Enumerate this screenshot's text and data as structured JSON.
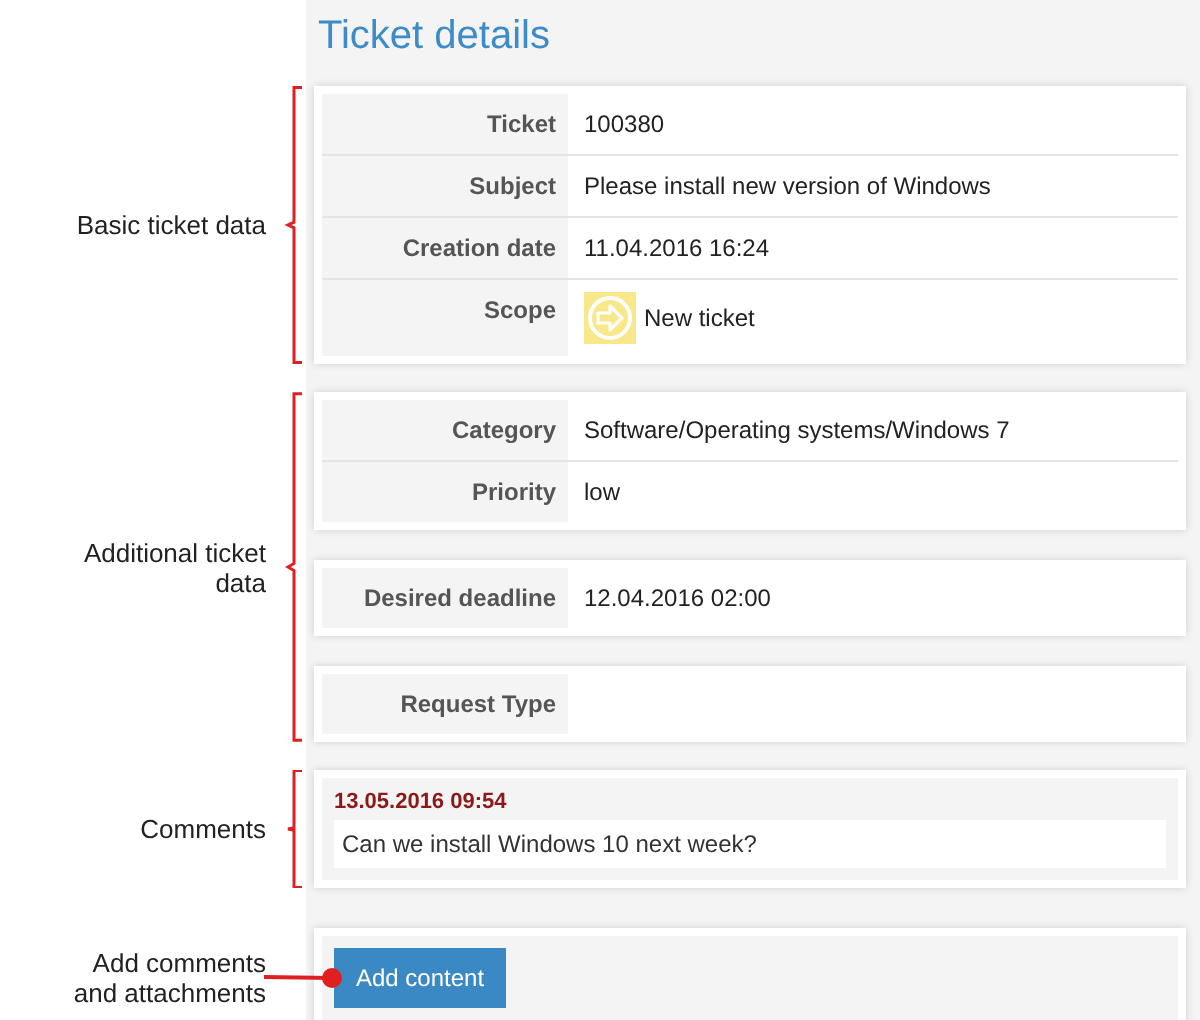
{
  "title": "Ticket details",
  "sections": [
    {
      "annotation": "Basic ticket data",
      "kind": "brace",
      "cards": [
        {
          "kind": "fields",
          "rows": [
            {
              "kind": "text",
              "label": "Ticket",
              "value": "100380"
            },
            {
              "kind": "text",
              "label": "Subject",
              "value": "Please install new version of Windows"
            },
            {
              "kind": "text",
              "label": "Creation date",
              "value": "11.04.2016 16:24"
            },
            {
              "kind": "icon",
              "label": "Scope",
              "value": "New ticket"
            }
          ]
        }
      ]
    },
    {
      "annotation": "Additional ticket data",
      "kind": "brace",
      "cards": [
        {
          "kind": "fields",
          "rows": [
            {
              "kind": "text",
              "label": "Category",
              "value": "Software/Operating systems/Windows 7"
            },
            {
              "kind": "text",
              "label": "Priority",
              "value": "low"
            }
          ]
        },
        {
          "kind": "fields",
          "rows": [
            {
              "kind": "text",
              "label": "Desired deadline",
              "value": "12.04.2016 02:00"
            }
          ]
        },
        {
          "kind": "fields",
          "rows": [
            {
              "kind": "text",
              "label": "Request Type"
            }
          ]
        }
      ]
    },
    {
      "annotation": "Comments",
      "kind": "brace",
      "cards": [
        {
          "kind": "comment",
          "timestamp": "13.05.2016 09:54",
          "text": "Can we install Windows 10 next week?"
        }
      ]
    },
    {
      "annotation": "Add comments and attachments",
      "kind": "pointer",
      "cards": [
        {
          "kind": "actions",
          "button": "Add content"
        }
      ]
    }
  ]
}
